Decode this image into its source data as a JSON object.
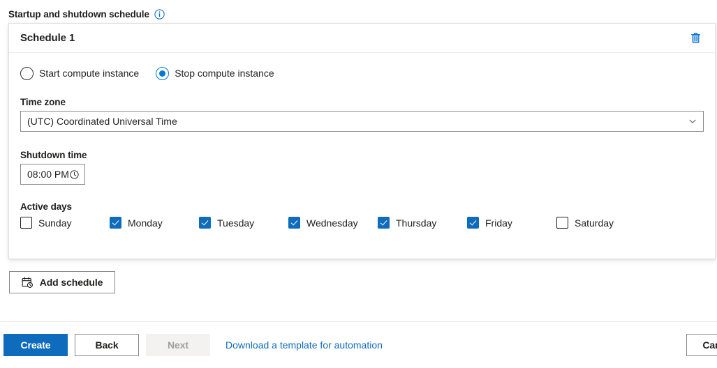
{
  "section": {
    "title": "Startup and shutdown schedule",
    "info_icon": "info-circle-icon",
    "info_tooltip": "Startup and shutdown schedule"
  },
  "card": {
    "title": "Schedule 1",
    "delete_icon": "trash-icon",
    "delete_tooltip": "Delete schedule",
    "action": {
      "selected": "stop",
      "options": [
        {
          "id": "start",
          "label": "Start compute instance",
          "checked": false
        },
        {
          "id": "stop",
          "label": "Stop compute instance",
          "checked": true
        }
      ]
    },
    "timezone": {
      "label": "Time zone",
      "value": "(UTC) Coordinated Universal Time",
      "chevron_icon": "chevron-down-icon"
    },
    "shutdown_time": {
      "label": "Shutdown time",
      "value": "08:00 PM",
      "clock_icon": "clock-icon"
    },
    "active_days": {
      "label": "Active days",
      "days": [
        {
          "label": "Sunday",
          "checked": false
        },
        {
          "label": "Monday",
          "checked": true
        },
        {
          "label": "Tuesday",
          "checked": true
        },
        {
          "label": "Wednesday",
          "checked": true
        },
        {
          "label": "Thursday",
          "checked": true
        },
        {
          "label": "Friday",
          "checked": true
        },
        {
          "label": "Saturday",
          "checked": false
        }
      ]
    }
  },
  "add_schedule": {
    "label": "Add schedule",
    "icon": "calendar-clock-icon"
  },
  "footer": {
    "create_label": "Create",
    "back_label": "Back",
    "next_label": "Next",
    "next_disabled": true,
    "download_link": "Download a template for automation",
    "cancel_label": "Cancel"
  },
  "colors": {
    "accent": "#0f6cbd",
    "radio_accent": "#0078d4",
    "link": "#0f6cbd",
    "text": "#201f1e",
    "border": "#8a8886",
    "card_border": "#e1dfdd",
    "disabled_bg": "#f3f2f1",
    "disabled_text": "#a19f9d"
  }
}
